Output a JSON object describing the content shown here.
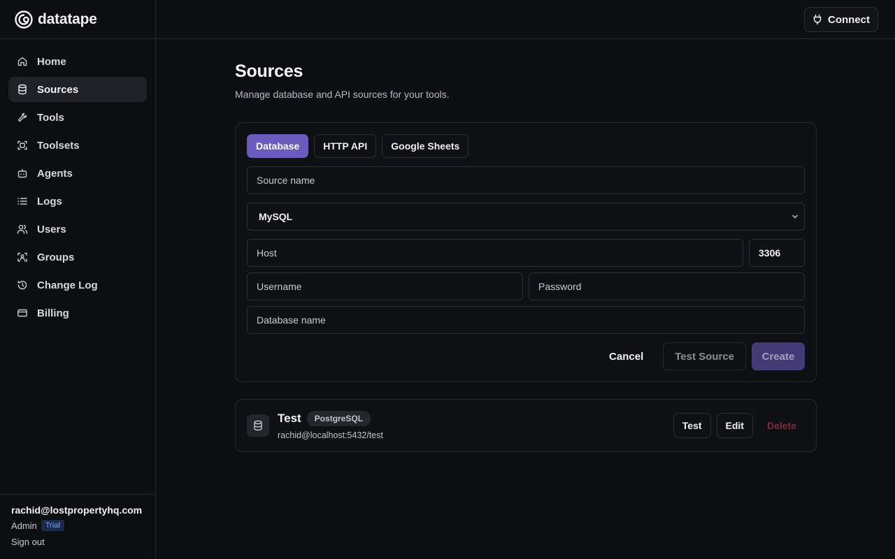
{
  "app": {
    "name": "datatape"
  },
  "topbar": {
    "connect_label": "Connect"
  },
  "sidebar": {
    "items": [
      {
        "label": "Home",
        "icon": "home-icon"
      },
      {
        "label": "Sources",
        "icon": "database-icon",
        "active": true
      },
      {
        "label": "Tools",
        "icon": "wrench-icon"
      },
      {
        "label": "Toolsets",
        "icon": "scan-icon"
      },
      {
        "label": "Agents",
        "icon": "bot-icon"
      },
      {
        "label": "Logs",
        "icon": "list-icon"
      },
      {
        "label": "Users",
        "icon": "users-icon"
      },
      {
        "label": "Groups",
        "icon": "group-icon"
      },
      {
        "label": "Change Log",
        "icon": "history-icon"
      },
      {
        "label": "Billing",
        "icon": "credit-card-icon"
      }
    ],
    "footer": {
      "email": "rachid@lostpropertyhq.com",
      "role": "Admin",
      "badge": "Trial",
      "signout_label": "Sign out"
    }
  },
  "page": {
    "title": "Sources",
    "subtitle": "Manage database and API sources for your tools."
  },
  "form": {
    "tabs": [
      {
        "label": "Database",
        "active": true
      },
      {
        "label": "HTTP API"
      },
      {
        "label": "Google Sheets"
      }
    ],
    "source_name_placeholder": "Source name",
    "db_type_selected": "MySQL",
    "host_placeholder": "Host",
    "port_value": "3306",
    "username_placeholder": "Username",
    "password_placeholder": "Password",
    "database_placeholder": "Database name",
    "cancel_label": "Cancel",
    "test_label": "Test Source",
    "create_label": "Create"
  },
  "sources": [
    {
      "name": "Test",
      "type": "PostgreSQL",
      "connection": "rachid@localhost:5432/test",
      "test_label": "Test",
      "edit_label": "Edit",
      "delete_label": "Delete"
    }
  ],
  "colors": {
    "accent": "#6a5bbd",
    "background": "#0d0e12",
    "danger": "#7c2d34"
  }
}
